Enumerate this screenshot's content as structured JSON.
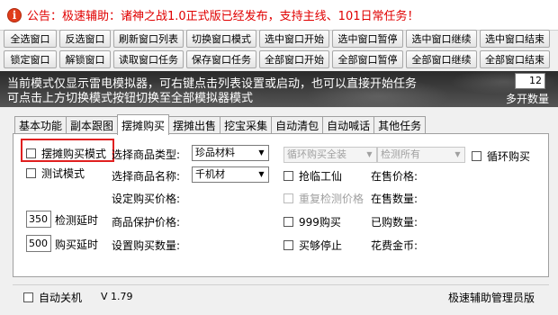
{
  "notice": {
    "icon": "info-icon",
    "text": "公告：极速辅助：诸神之战1.0正式版已经发布，支持主线、101日常任务！"
  },
  "toolbar_row1": [
    "全选窗口",
    "反选窗口",
    "刷新窗口列表",
    "切换窗口模式",
    "选中窗口开始",
    "选中窗口暂停",
    "选中窗口继续",
    "选中窗口结束"
  ],
  "toolbar_row2": [
    "锁定窗口",
    "解锁窗口",
    "读取窗口任务",
    "保存窗口任务",
    "全部窗口开始",
    "全部窗口暂停",
    "全部窗口继续",
    "全部窗口结束"
  ],
  "log": {
    "line1": "当前模式仅显示雷电模拟器，可右键点击列表设置或启动，也可以直接开始任务",
    "line2": "可点击上方切换模式按钮切换至全部模拟器模式",
    "open_count": "12",
    "open_count_label": "多开数量"
  },
  "tabs": [
    "基本功能",
    "副本跟图",
    "摆摊购买",
    "摆摊出售",
    "挖宝采集",
    "自动清包",
    "自动喊话",
    "其他任务"
  ],
  "active_tab": 2,
  "panel": {
    "buy_mode": "摆摊购买模式",
    "test_mode": "测试模式",
    "detect_delay_value": "350",
    "detect_delay_label": "检测延时",
    "buy_delay_value": "500",
    "buy_delay_label": "购买延时",
    "item_type_label": "选择商品类型:",
    "item_type_value": "珍品材料",
    "item_name_label": "选择商品名称:",
    "item_name_value": "千机材",
    "set_price_label": "设定购买价格:",
    "protect_price_label": "商品保护价格:",
    "set_qty_label": "设置购买数量:",
    "loop_mode_value": "循环购买全装",
    "detect_all_value": "检测所有",
    "loop_buy": "循环购买",
    "rush_gongxian": "抢临工仙",
    "recheck_price": "重复检测价格",
    "buy_999": "999购买",
    "stop_when_enough": "买够停止",
    "on_sale_price": "在售价格:",
    "on_sale_qty": "在售数量:",
    "bought_qty": "已购数量:",
    "gold_spent": "花费金币:"
  },
  "status": {
    "auto_shutdown": "自动关机",
    "version": "V 1.79",
    "edition": "极速辅助管理员版"
  },
  "colors": {
    "notice_text": "#e00000",
    "highlight": "#e02020"
  }
}
